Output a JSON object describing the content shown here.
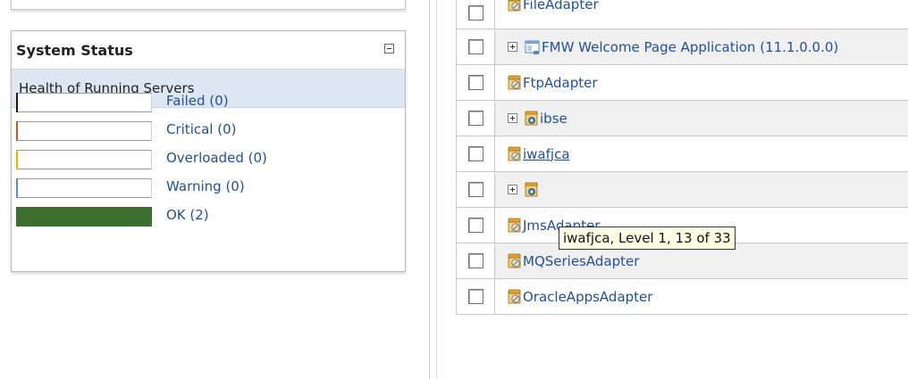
{
  "system_status": {
    "title": "System Status",
    "subtitle": "Health of Running Servers",
    "legend": [
      {
        "label": "Failed (0)",
        "color": "#1a1a1a",
        "level": 0
      },
      {
        "label": "Critical (0)",
        "color": "#d9531e",
        "level": 0
      },
      {
        "label": "Overloaded (0)",
        "color": "#f0b000",
        "level": 0
      },
      {
        "label": "Warning (0)",
        "color": "#5b8fc9",
        "level": 0
      },
      {
        "label": "OK (2)",
        "color": "#3c6e2f",
        "level": 1
      }
    ]
  },
  "deployments": {
    "rows": [
      {
        "label": "FileAdapter",
        "icon": "adapter-icon",
        "expandable": false
      },
      {
        "label": "FMW Welcome Page Application (11.1.0.0.0)",
        "icon": "application-icon",
        "expandable": true
      },
      {
        "label": "FtpAdapter",
        "icon": "adapter-icon",
        "expandable": false
      },
      {
        "label": "ibse",
        "icon": "library-icon",
        "expandable": true
      },
      {
        "label": "iwafjca",
        "icon": "adapter-icon",
        "expandable": false
      },
      {
        "label": "",
        "icon": "library-icon",
        "expandable": true
      },
      {
        "label": "JmsAdapter",
        "icon": "adapter-icon",
        "expandable": false
      },
      {
        "label": "MQSeriesAdapter",
        "icon": "adapter-icon",
        "expandable": false
      },
      {
        "label": "OracleAppsAdapter",
        "icon": "adapter-icon",
        "expandable": false
      }
    ]
  },
  "tooltip": {
    "text": "iwafjca, Level 1, 13 of 33"
  }
}
